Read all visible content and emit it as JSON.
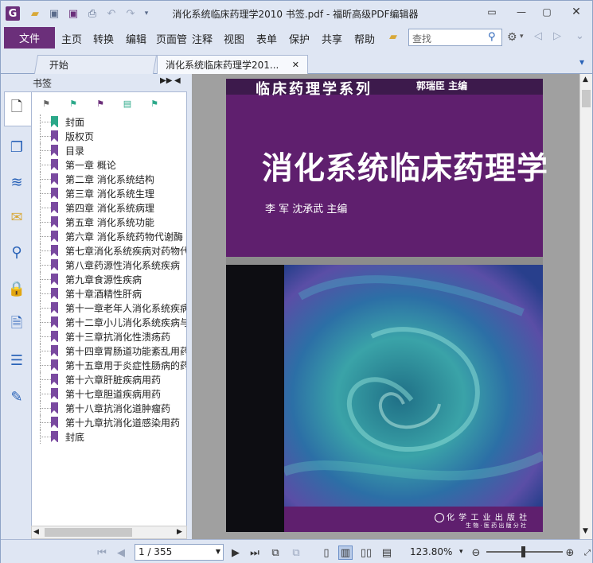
{
  "window": {
    "title": "消化系统临床药理学2010 书签.pdf - 福昕高级PDF编辑器",
    "quick_access_icons": [
      "app-logo-icon",
      "open-folder-icon",
      "save-icon",
      "save-as-icon",
      "print-icon",
      "undo-icon",
      "redo-icon",
      "customize-dropdown-icon"
    ],
    "controls": [
      "ribbon-toggle-icon",
      "minimize-icon",
      "maximize-icon",
      "close-icon"
    ]
  },
  "menu": {
    "file": "文件",
    "items": [
      "主页",
      "转换",
      "编辑",
      "页面管",
      "注释",
      "视图",
      "表单",
      "保护",
      "共享",
      "帮助"
    ],
    "search_placeholder": "查找"
  },
  "tabs": {
    "start": "开始",
    "document": "消化系统临床药理学201..."
  },
  "bookmarks": {
    "header": "书签",
    "items": [
      "封面",
      "版权页",
      "目录",
      "第一章 概论",
      "第二章 消化系统结构",
      "第三章 消化系统生理",
      "第四章 消化系统病理",
      "第五章 消化系统功能",
      "第六章 消化系统药物代谢酶",
      "第七章消化系统疾病对药物代",
      "第八章药源性消化系统疾病",
      "第九章食源性疾病",
      "第十章酒精性肝病",
      "第十一章老年人消化系统疾病",
      "第十二章小儿消化系统疾病与",
      "第十三章抗消化性溃疡药",
      "第十四章胃肠道功能紊乱用药",
      "第十五章用于炎症性肠病的药",
      "第十六章肝脏疾病用药",
      "第十七章胆道疾病用药",
      "第十八章抗消化道肿瘤药",
      "第十九章抗消化道感染用药",
      "封底"
    ]
  },
  "cover": {
    "series": "临床药理学系列",
    "series_editor": "郭瑞臣  主编",
    "title": "消化系统临床药理学",
    "authors": "李  军   沈承武  主编",
    "publisher": "化 学 工 业 出 版 社",
    "publisher_sub": "生 物 · 医 药 出 版 分 社"
  },
  "status": {
    "page": "1 / 355",
    "zoom": "123.80%"
  }
}
